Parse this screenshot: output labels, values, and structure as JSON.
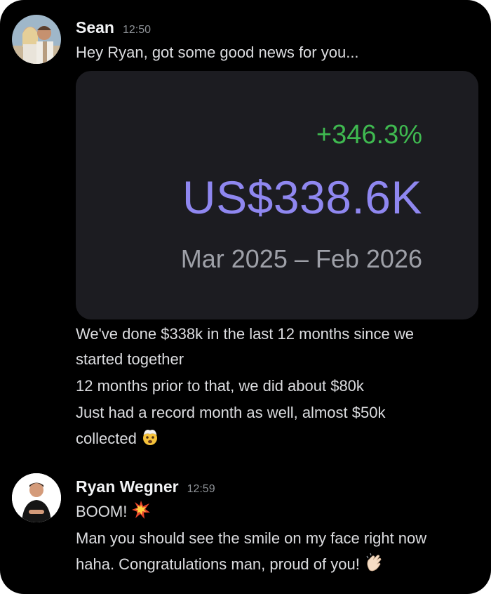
{
  "messages": [
    {
      "author": "Sean",
      "time": "12:50",
      "lines_before": [
        "Hey Ryan, got some good news for you..."
      ],
      "card": {
        "change": "+346.3%",
        "total": "US$338.6K",
        "range": "Mar 2025 – Feb 2026"
      },
      "lines_after": [
        "We've done $338k in the last 12 months since we",
        "started together",
        "12 months prior to that, we did about $80k",
        "Just had a record month as well, almost $50k",
        "collected"
      ],
      "emoji": "exploding-head-emoji"
    },
    {
      "author": "Ryan Wegner",
      "time": "12:59",
      "lines": [
        "BOOM!",
        "Man you should see the smile on my face right now",
        "haha. Congratulations man, proud of you!"
      ],
      "emojis": [
        "collision-emoji",
        "clapping-hands-emoji"
      ]
    }
  ],
  "colors": {
    "background": "#000000",
    "card": "#1c1c21",
    "positive": "#3fb950",
    "total": "#8f87f0",
    "text": "#dcdde0",
    "muted": "#8e9297"
  }
}
